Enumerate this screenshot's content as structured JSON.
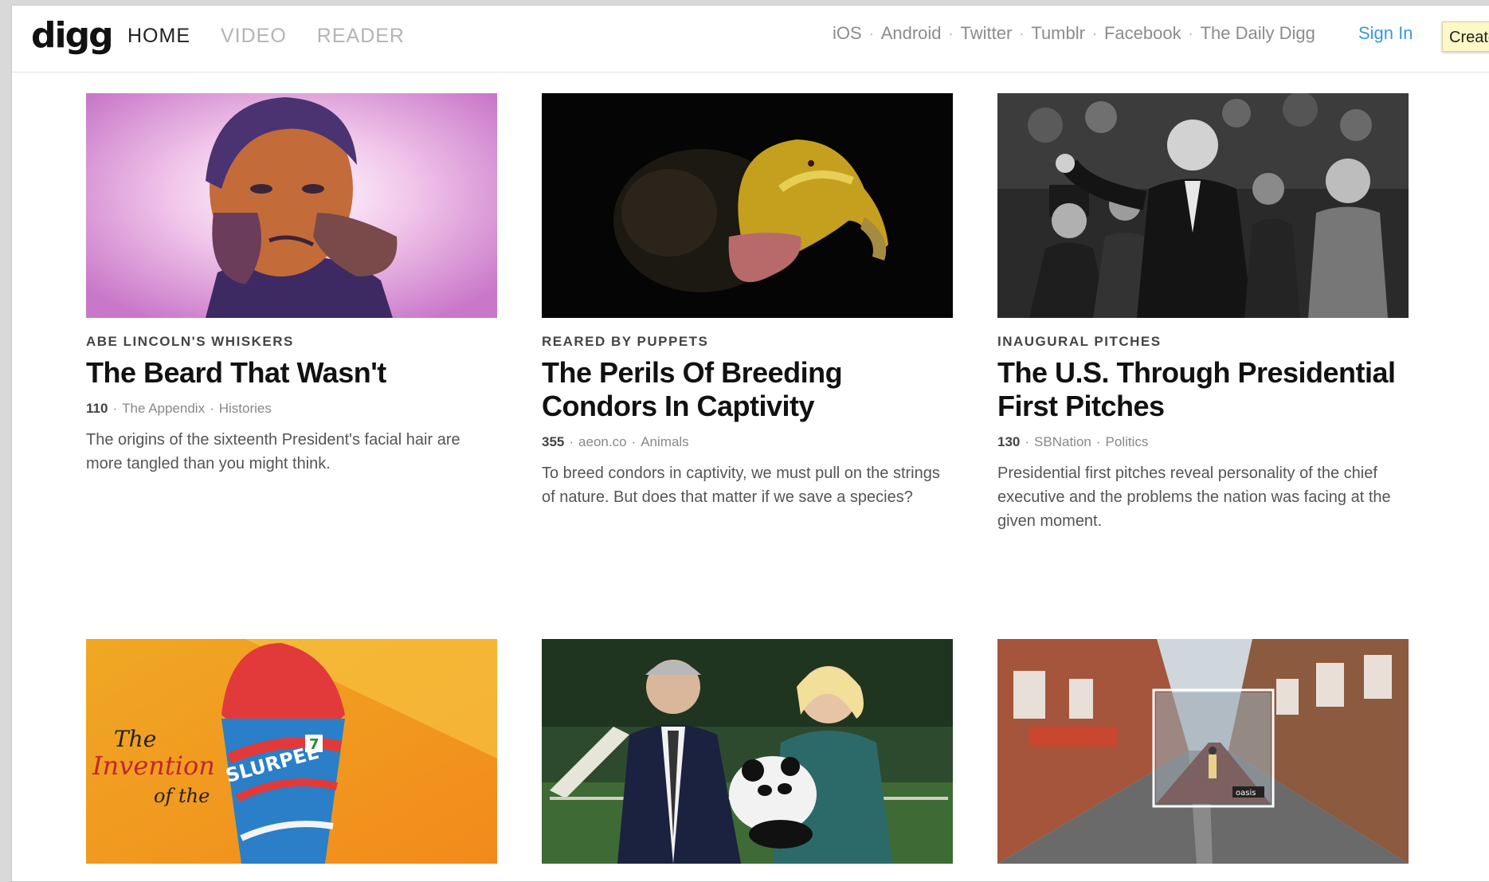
{
  "header": {
    "logo": "digg",
    "nav": [
      {
        "label": "HOME",
        "active": true
      },
      {
        "label": "VIDEO",
        "active": false
      },
      {
        "label": "READER",
        "active": false
      }
    ],
    "links": [
      "iOS",
      "Android",
      "Twitter",
      "Tumblr",
      "Facebook",
      "The Daily Digg"
    ],
    "sign_in": "Sign In",
    "create": "Create"
  },
  "stories": [
    {
      "kicker": "ABE LINCOLN'S WHISKERS",
      "title": "The Beard That Wasn't",
      "diggs": "110",
      "source": "The Appendix",
      "category": "Histories",
      "description": "The origins of the sixteenth President's facial hair are more tangled than you might think.",
      "image": "portrait-illustration"
    },
    {
      "kicker": "REARED BY PUPPETS",
      "title": "The Perils Of Breeding Condors In Captivity",
      "diggs": "355",
      "source": "aeon.co",
      "category": "Animals",
      "description": "To breed condors in captivity, we must pull on the strings of nature. But does that matter if we save a species?",
      "image": "condor-photo"
    },
    {
      "kicker": "INAUGURAL PITCHES",
      "title": "The U.S. Through Presidential First Pitches",
      "diggs": "130",
      "source": "SBNation",
      "category": "Politics",
      "description": "Presidential first pitches reveal personality of the chief executive and the problems the nation was facing at the given moment.",
      "image": "historic-photo"
    },
    {
      "image": "slurpee-illustration",
      "image_text": {
        "line1": "The",
        "line2": "Invention",
        "line3": "of the",
        "cup": "SLURPEE",
        "badge": "7"
      }
    },
    {
      "image": "panda-photo"
    },
    {
      "image": "street-view-photo",
      "image_text": {
        "album": "oasis"
      }
    }
  ],
  "colors": {
    "link_blue": "#3a9ad9",
    "create_bg": "#fdf8c6",
    "nav_inactive": "#b4b4b4"
  }
}
